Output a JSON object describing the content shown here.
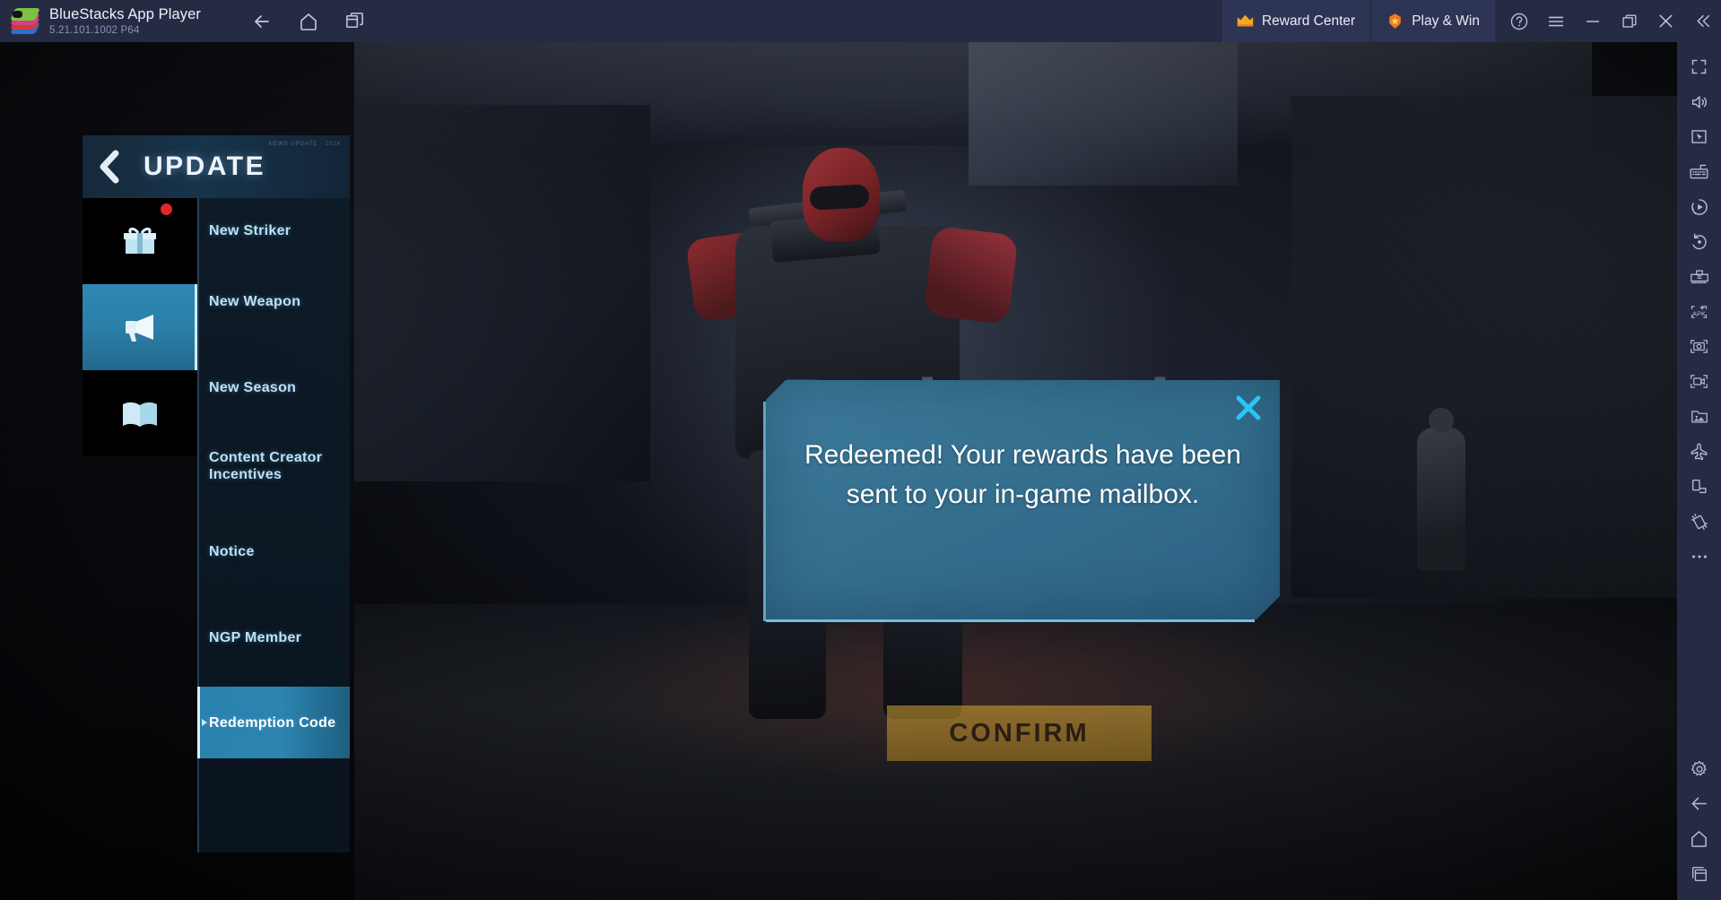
{
  "titlebar": {
    "app_title": "BlueStacks App Player",
    "version": "5.21.101.1002  P64",
    "logo_icon": "bluestacks-logo",
    "nav": [
      {
        "name": "back",
        "icon": "arrow-left-icon"
      },
      {
        "name": "home",
        "icon": "home-icon"
      },
      {
        "name": "multi-instance",
        "icon": "windows-stack-icon"
      }
    ],
    "reward_center_label": "Reward Center",
    "reward_center_icon": "crown-icon",
    "play_win_label": "Play & Win",
    "play_win_icon": "star-badge-icon",
    "window_buttons": [
      {
        "name": "help",
        "icon": "question-circle-icon"
      },
      {
        "name": "menu",
        "icon": "hamburger-icon"
      },
      {
        "name": "minimize",
        "icon": "minimize-icon"
      },
      {
        "name": "maximize",
        "icon": "restore-icon"
      },
      {
        "name": "close",
        "icon": "close-icon"
      },
      {
        "name": "collapse-sidebar",
        "icon": "chevron-double-left-icon"
      }
    ]
  },
  "right_sidebar": {
    "items": [
      {
        "name": "fullscreen",
        "icon": "fullscreen-icon"
      },
      {
        "name": "volume",
        "icon": "speaker-icon"
      },
      {
        "name": "game-controls",
        "icon": "cursor-box-icon"
      },
      {
        "name": "keymapping",
        "icon": "keyboard-icon"
      },
      {
        "name": "macro-recorder",
        "icon": "play-record-icon"
      },
      {
        "name": "operation-recorder",
        "icon": "rotate-dot-icon"
      },
      {
        "name": "multi-instance-manager",
        "icon": "instance-manager-icon"
      },
      {
        "name": "install-apk",
        "icon": "apk-icon"
      },
      {
        "name": "screenshot",
        "icon": "camera-icon"
      },
      {
        "name": "screen-record",
        "icon": "video-camera-icon"
      },
      {
        "name": "media-manager",
        "icon": "folder-image-icon"
      },
      {
        "name": "eco-mode",
        "icon": "airplane-icon"
      },
      {
        "name": "rotate-screen",
        "icon": "rotate-screen-icon"
      },
      {
        "name": "shake",
        "icon": "shake-icon"
      },
      {
        "name": "more",
        "icon": "ellipsis-icon"
      },
      {
        "name": "settings",
        "icon": "gear-icon"
      },
      {
        "name": "android-back",
        "icon": "arrow-left-icon"
      },
      {
        "name": "android-home",
        "icon": "home-icon"
      },
      {
        "name": "android-recents",
        "icon": "recents-icon"
      }
    ]
  },
  "game": {
    "background_title": "Redemption Code",
    "panel": {
      "title": "UPDATE",
      "title_decoration": "NEWS UPDATE · 2024",
      "back_icon": "chevron-left-icon",
      "rail_icons": [
        {
          "name": "gift",
          "icon": "gift-icon",
          "badge": true,
          "active": false
        },
        {
          "name": "announcement",
          "icon": "megaphone-icon",
          "badge": false,
          "active": true
        },
        {
          "name": "guide",
          "icon": "book-icon",
          "badge": false,
          "active": false
        }
      ],
      "list_items": [
        {
          "label": "New Striker",
          "selected": false
        },
        {
          "label": "New Weapon",
          "selected": false
        },
        {
          "label": "New Season",
          "selected": false
        },
        {
          "label": "Content Creator Incentives",
          "selected": false
        },
        {
          "label": "Notice",
          "selected": false
        },
        {
          "label": "NGP Member",
          "selected": false
        },
        {
          "label": "Redemption Code",
          "selected": true
        }
      ]
    },
    "dialog": {
      "message": "Redeemed! Your rewards have been sent to your in-game mailbox.",
      "close_icon": "close-x-icon"
    },
    "confirm_label": "CONFIRM"
  },
  "colors": {
    "titlebar_bg": "#262b44",
    "pill_bg": "#2e3453",
    "accent_cyan": "#7fd0ee",
    "panel_active": "#2d88b4",
    "dialog_bg": "#3d7a9c",
    "confirm_gold": "#d9a833",
    "badge_red": "#e0252b"
  }
}
